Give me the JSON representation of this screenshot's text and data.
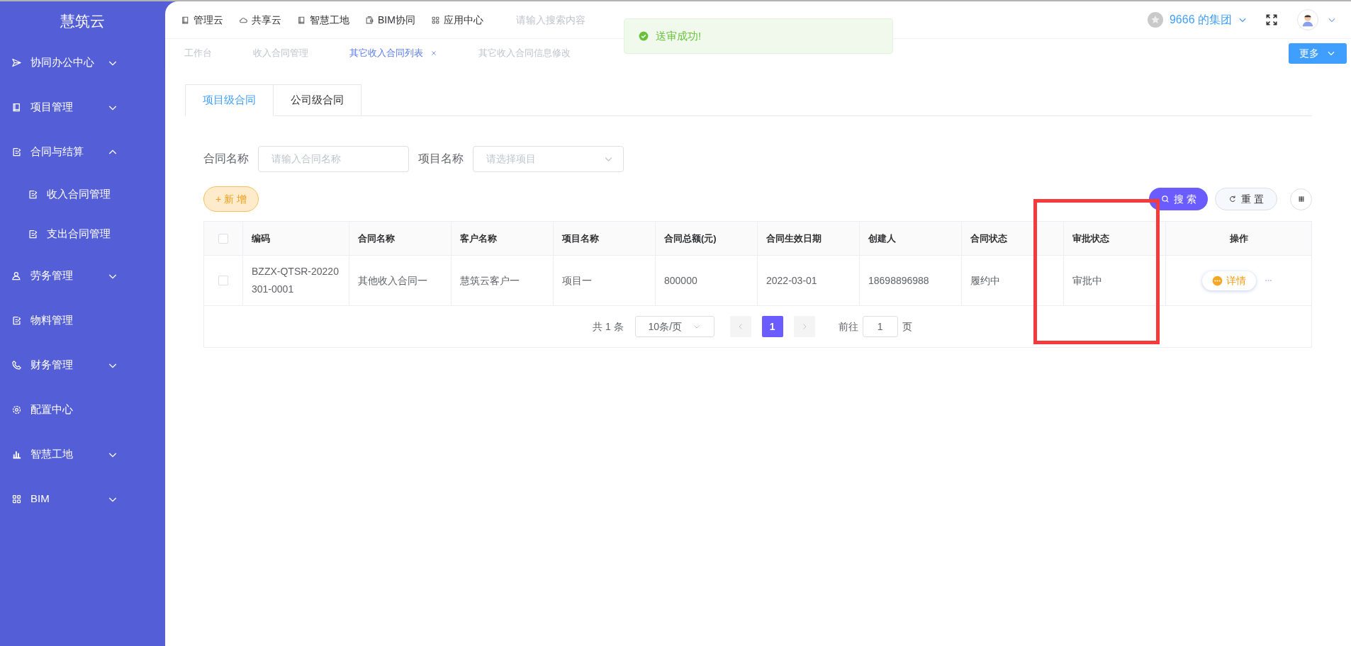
{
  "app": {
    "logo": "慧筑云"
  },
  "sidebar": {
    "items": [
      {
        "label": "协同办公中心",
        "expanded": false
      },
      {
        "label": "项目管理",
        "expanded": false
      },
      {
        "label": "合同与结算",
        "expanded": true,
        "children": [
          {
            "label": "收入合同管理"
          },
          {
            "label": "支出合同管理"
          }
        ]
      },
      {
        "label": "劳务管理",
        "expanded": false
      },
      {
        "label": "物料管理"
      },
      {
        "label": "财务管理",
        "expanded": false
      },
      {
        "label": "配置中心"
      },
      {
        "label": "智慧工地",
        "expanded": false
      },
      {
        "label": "BIM",
        "expanded": false
      }
    ]
  },
  "top_nav": [
    {
      "label": "管理云"
    },
    {
      "label": "共享云"
    },
    {
      "label": "智慧工地"
    },
    {
      "label": "BIM协同"
    },
    {
      "label": "应用中心"
    }
  ],
  "search": {
    "placeholder": "请输入搜索内容"
  },
  "org": {
    "name": "9666 的集团"
  },
  "toast": {
    "message": "送审成功!"
  },
  "page_tabs": [
    {
      "label": "工作台",
      "selected": false
    },
    {
      "label": "收入合同管理",
      "selected": false
    },
    {
      "label": "其它收入合同列表",
      "selected": true
    },
    {
      "label": "其它收入合同信息修改",
      "selected": false
    }
  ],
  "more_button": "更多",
  "contract_tabs": [
    {
      "label": "项目级合同",
      "selected": true
    },
    {
      "label": "公司级合同",
      "selected": false
    }
  ],
  "filters": [
    {
      "label": "合同名称",
      "kind": "input",
      "placeholder": "请输入合同名称"
    },
    {
      "label": "项目名称",
      "kind": "select",
      "placeholder": "请选择项目"
    }
  ],
  "buttons": {
    "add": "+ 新 增",
    "search": "搜 索",
    "reset": "重 置"
  },
  "table": {
    "select_all_checked": false,
    "columns": [
      "编码",
      "合同名称",
      "客户名称",
      "项目名称",
      "合同总额(元)",
      "合同生效日期",
      "创建人",
      "合同状态",
      "审批状态",
      "操作"
    ],
    "rows": [
      {
        "checked": false,
        "cells": [
          "BZZX-QTSR-20220301-0001",
          "其他收入合同一",
          "慧筑云客户一",
          "项目一",
          "800000",
          "2022-03-01",
          "18698896988",
          "履约中",
          "审批中"
        ],
        "action": "详情"
      }
    ]
  },
  "pagination": {
    "total": "共 1 条",
    "page_size": "10条/页",
    "pages": [
      {
        "label": "1",
        "selected": true
      }
    ],
    "goto_label": "前往",
    "goto_value": "1",
    "goto_suffix": "页"
  }
}
